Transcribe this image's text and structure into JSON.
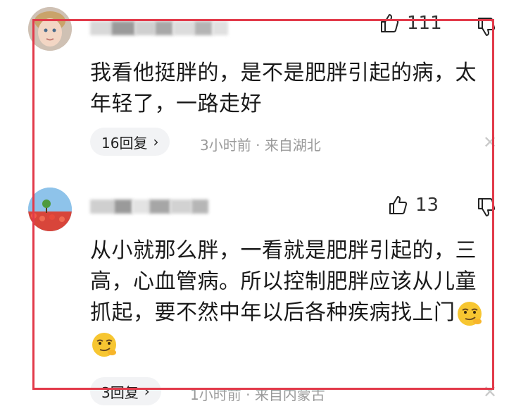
{
  "comments": [
    {
      "likes": "111",
      "text": "我看他挺胖的，是不是肥胖引起的病，太年轻了，一路走好",
      "replies": "16回复",
      "time": "3小时前",
      "location": "来自湖北"
    },
    {
      "likes": "13",
      "text": "从小就那么胖，一看就是肥胖引起的，三高，心血管病。所以控制肥胖应该从儿童抓起，要不然中年以后各种疾病找上门",
      "replies": "3回复",
      "time": "1小时前",
      "location": "来自内蒙古"
    }
  ],
  "separator": "·",
  "icons": {
    "like": "thumbs-up-icon",
    "dislike": "thumbs-down-icon",
    "chevron": "chevron-right-icon",
    "close": "close-icon",
    "emoji": "smirk-emoji-icon"
  },
  "colors": {
    "frame": "#e23a4a",
    "meta": "#9a9a9a",
    "pill": "#f2f3f5"
  }
}
